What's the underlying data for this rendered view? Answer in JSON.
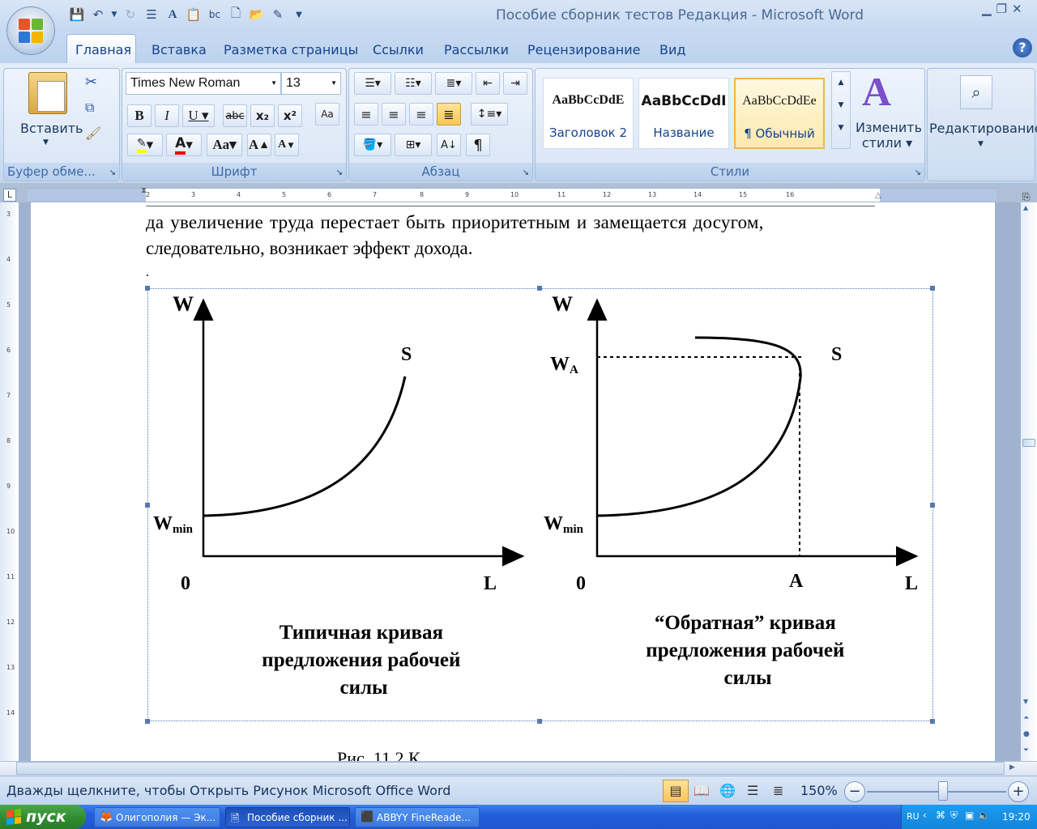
{
  "window": {
    "title": "Пособие сборник тестов Редакция - Microsoft Word"
  },
  "tabs": [
    "Главная",
    "Вставка",
    "Разметка страницы",
    "Ссылки",
    "Рассылки",
    "Рецензирование",
    "Вид"
  ],
  "clipboard": {
    "paste_label": "Вставить",
    "group_title": "Буфер обме..."
  },
  "font": {
    "name": "Times New Roman",
    "size": "13",
    "group_title": "Шрифт"
  },
  "paragraph": {
    "group_title": "Абзац"
  },
  "styles": {
    "group_title": "Стили",
    "items": [
      {
        "preview": "AaBbCcDdE",
        "name": "Заголовок 2"
      },
      {
        "preview": "AaBbCcDdI",
        "name": "Название"
      },
      {
        "preview": "AaBbCcDdEe",
        "name": "¶ Обычный"
      }
    ],
    "change_label_1": "Изменить",
    "change_label_2": "стили"
  },
  "editing": {
    "label": "Редактирование"
  },
  "ruler_numbers": [
    "2",
    "1",
    "1",
    "2",
    "3",
    "4",
    "5",
    "6",
    "7",
    "8",
    "9",
    "10",
    "11",
    "12",
    "13",
    "14",
    "15",
    "16",
    "17",
    "18"
  ],
  "vruler_numbers": [
    "3",
    "4",
    "5",
    "6",
    "7",
    "8",
    "9",
    "10",
    "11",
    "12",
    "13",
    "14"
  ],
  "document": {
    "line1": "да увеличение труда перестает быть приоритетным и замещается досугом,",
    "line2": "следовательно, возникает эффект дохода.",
    "dot": ".",
    "caption_partial": "Рис. 11.2 К..."
  },
  "figure": {
    "left": {
      "y_axis": "W",
      "curve": "S",
      "wmin": "W",
      "wmin_sub": "min",
      "origin": "0",
      "x_axis": "L",
      "caption": [
        "Типичная кривая",
        "предложения рабочей",
        "силы"
      ]
    },
    "right": {
      "y_axis": "W",
      "curve": "S",
      "wa": "W",
      "wa_sub": "A",
      "wmin": "W",
      "wmin_sub": "min",
      "origin": "0",
      "a_label": "A",
      "x_axis": "L",
      "caption": [
        "“Обратная” кривая",
        "предложения рабочей",
        "силы"
      ]
    }
  },
  "status": {
    "hint": "Дважды щелкните, чтобы Открыть Рисунок Microsoft Office Word",
    "zoom": "150%"
  },
  "taskbar": {
    "start": "пуск",
    "tasks": [
      "Олигополия — Эк...",
      "Пособие сборник ...",
      "ABBYY FineReade..."
    ],
    "lang": "RU",
    "clock": "19:20"
  }
}
